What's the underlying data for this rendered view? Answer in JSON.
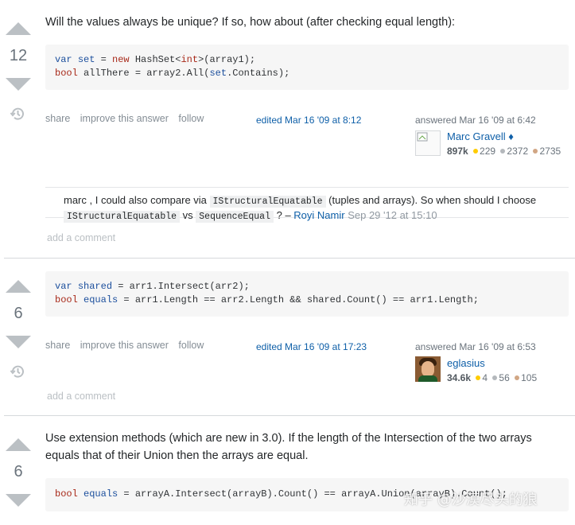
{
  "answers": [
    {
      "votes": "12",
      "body": "Will the values always be unique? If so, how about (after checking equal length):",
      "code_lines": [
        [
          {
            "t": "kw",
            "s": "var"
          },
          {
            "t": "pl",
            "s": " "
          },
          {
            "t": "kw",
            "s": "set"
          },
          {
            "t": "pl",
            "s": " = "
          },
          {
            "t": "ty",
            "s": "new"
          },
          {
            "t": "pl",
            "s": " HashSet<"
          },
          {
            "t": "ty",
            "s": "int"
          },
          {
            "t": "pl",
            "s": ">(array1);"
          }
        ],
        [
          {
            "t": "ty",
            "s": "bool"
          },
          {
            "t": "pl",
            "s": " allThere = array2.All("
          },
          {
            "t": "kw",
            "s": "set"
          },
          {
            "t": "pl",
            "s": ".Contains);"
          }
        ]
      ],
      "menu": [
        "share",
        "improve this answer",
        "follow"
      ],
      "edited": "edited Mar 16 '09 at 8:12",
      "answered": "answered Mar 16 '09 at 6:42",
      "user": {
        "name": "Marc Gravell ♦",
        "rep": "897k",
        "gold": "229",
        "silver": "2372",
        "bronze": "2735"
      },
      "comment": {
        "pre": "marc , I could also compare via ",
        "code1": "IStructuralEquatable",
        "mid": " (tuples and arrays). So when should I choose ",
        "code2": "IStructuralEquatable",
        "vs": " vs ",
        "code3": "SequenceEqual",
        "post": " ? – ",
        "author": "Royi Namir",
        "date": "Sep 29 '12 at 15:10"
      },
      "add_comment": "add a comment"
    },
    {
      "votes": "6",
      "code_lines": [
        [
          {
            "t": "kw",
            "s": "var"
          },
          {
            "t": "pl",
            "s": " "
          },
          {
            "t": "kw",
            "s": "shared"
          },
          {
            "t": "pl",
            "s": " = arr1.Intersect(arr2);"
          }
        ],
        [
          {
            "t": "ty",
            "s": "bool"
          },
          {
            "t": "pl",
            "s": " "
          },
          {
            "t": "kw",
            "s": "equals"
          },
          {
            "t": "pl",
            "s": " = arr1.Length == arr2.Length && shared.Count() == arr1.Length;"
          }
        ]
      ],
      "menu": [
        "share",
        "improve this answer",
        "follow"
      ],
      "edited": "edited Mar 16 '09 at 17:23",
      "answered": "answered Mar 16 '09 at 6:53",
      "user": {
        "name": "eglasius",
        "rep": "34.6k",
        "gold": "4",
        "silver": "56",
        "bronze": "105"
      },
      "add_comment": "add a comment"
    },
    {
      "votes": "6",
      "body": "Use extension methods (which are new in 3.0). If the length of the Intersection of the two arrays equals that of their Union then the arrays are equal.",
      "code_lines": [
        [
          {
            "t": "ty",
            "s": "bool"
          },
          {
            "t": "pl",
            "s": " "
          },
          {
            "t": "kw",
            "s": "equals"
          },
          {
            "t": "pl",
            "s": " = arrayA.Intersect(arrayB).Count() == arrayA.Union(arrayB).Count();"
          }
        ]
      ]
    }
  ],
  "watermark": "知乎 @沙漠尽头的狼"
}
